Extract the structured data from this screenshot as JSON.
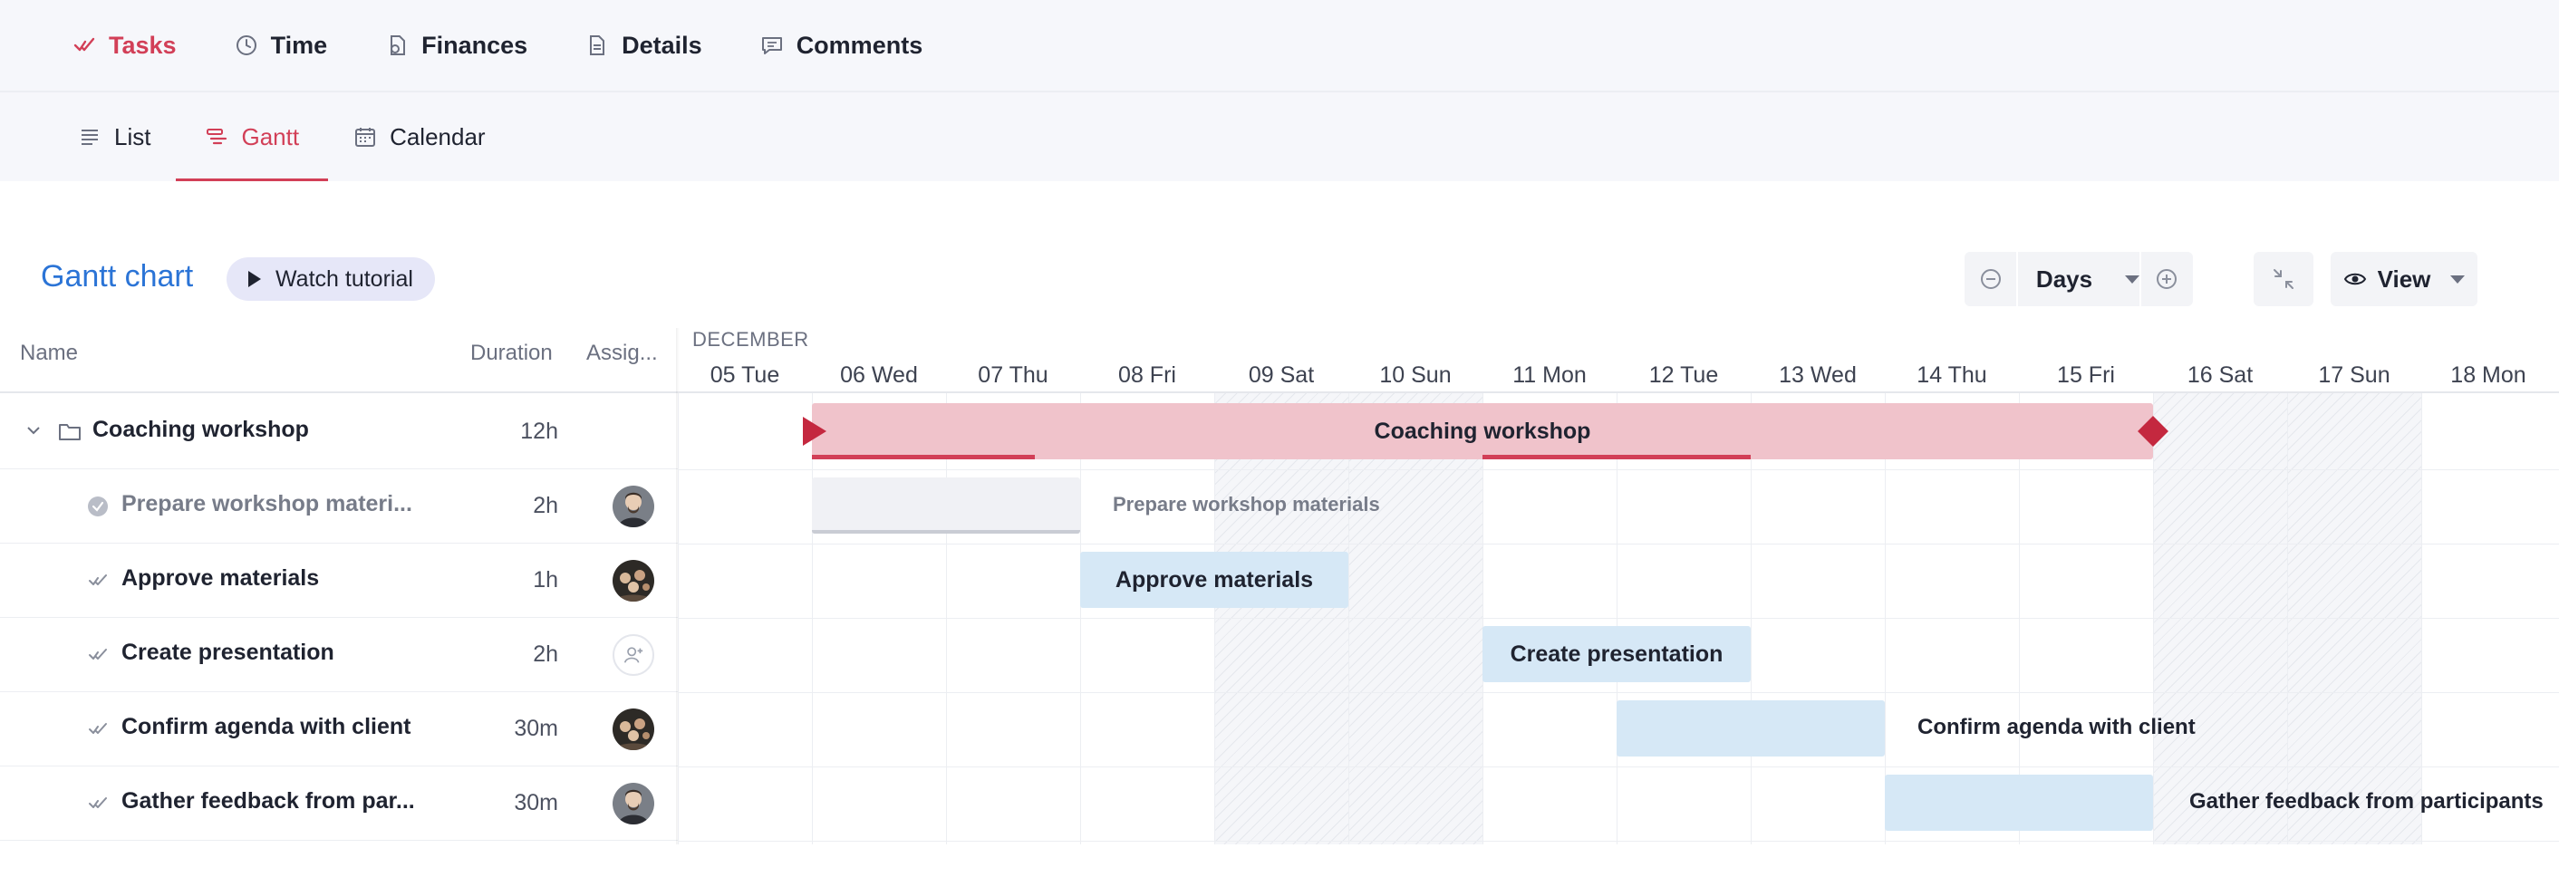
{
  "top_nav": {
    "tabs": [
      {
        "label": "Tasks",
        "icon": "tasks-check-icon",
        "active": true
      },
      {
        "label": "Time",
        "icon": "clock-icon",
        "active": false
      },
      {
        "label": "Finances",
        "icon": "finances-icon",
        "active": false
      },
      {
        "label": "Details",
        "icon": "document-icon",
        "active": false
      },
      {
        "label": "Comments",
        "icon": "comment-icon",
        "active": false
      }
    ]
  },
  "sub_nav": {
    "tabs": [
      {
        "label": "List",
        "icon": "list-icon",
        "active": false
      },
      {
        "label": "Gantt",
        "icon": "gantt-icon",
        "active": true
      },
      {
        "label": "Calendar",
        "icon": "calendar-icon",
        "active": false
      }
    ]
  },
  "header": {
    "title": "Gantt chart",
    "tutorial_label": "Watch tutorial",
    "scale_label": "Days",
    "view_label": "View"
  },
  "table": {
    "columns": {
      "name": "Name",
      "duration": "Duration",
      "assignee": "Assig..."
    },
    "rows": [
      {
        "name": "Coaching workshop",
        "duration": "12h",
        "type": "project"
      },
      {
        "name": "Prepare workshop materi...",
        "duration": "2h",
        "type": "task",
        "done": true,
        "assignee": "avatar-man-1"
      },
      {
        "name": "Approve materials",
        "duration": "1h",
        "type": "task",
        "done": false,
        "assignee": "avatar-group"
      },
      {
        "name": "Create presentation",
        "duration": "2h",
        "type": "task",
        "done": false,
        "assignee": "none"
      },
      {
        "name": "Confirm agenda with client",
        "duration": "30m",
        "type": "task",
        "done": false,
        "assignee": "avatar-group"
      },
      {
        "name": "Gather feedback from par...",
        "duration": "30m",
        "type": "task",
        "done": false,
        "assignee": "avatar-man-1"
      }
    ]
  },
  "timeline": {
    "month": "DECEMBER",
    "days": [
      {
        "label": "05 Tue",
        "weekend": false
      },
      {
        "label": "06 Wed",
        "weekend": false
      },
      {
        "label": "07 Thu",
        "weekend": false
      },
      {
        "label": "08 Fri",
        "weekend": false
      },
      {
        "label": "09 Sat",
        "weekend": true
      },
      {
        "label": "10 Sun",
        "weekend": true
      },
      {
        "label": "11 Mon",
        "weekend": false
      },
      {
        "label": "12 Tue",
        "weekend": false
      },
      {
        "label": "13 Wed",
        "weekend": false
      },
      {
        "label": "14 Thu",
        "weekend": false
      },
      {
        "label": "15 Fri",
        "weekend": false
      },
      {
        "label": "16 Sat",
        "weekend": true
      },
      {
        "label": "17 Sun",
        "weekend": true
      },
      {
        "label": "18 Mon",
        "weekend": false
      }
    ],
    "bars": {
      "project": "Coaching workshop",
      "prepare": "Prepare workshop materials",
      "approve": "Approve materials",
      "create": "Create presentation",
      "confirm": "Confirm agenda with client",
      "gather": "Gather feedback from participants"
    }
  },
  "colors": {
    "accent": "#d23f57",
    "link": "#2b74d6",
    "project_bar": "#f0c3cb",
    "task_bar": "#d6e8f6"
  }
}
